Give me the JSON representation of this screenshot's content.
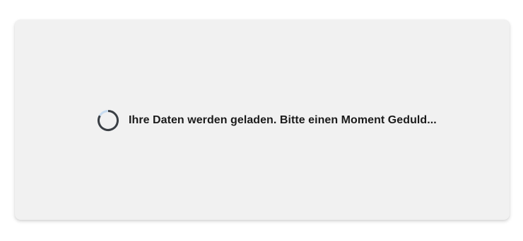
{
  "loading": {
    "message": "Ihre Daten werden geladen. Bitte einen Moment Geduld...",
    "spinner_icon": "loading-spinner-icon",
    "colors": {
      "card_background": "#f1f1f1",
      "spinner_track": "#c7dcf0",
      "spinner_arc": "#3b3f44",
      "text": "#1b1b1b"
    }
  }
}
